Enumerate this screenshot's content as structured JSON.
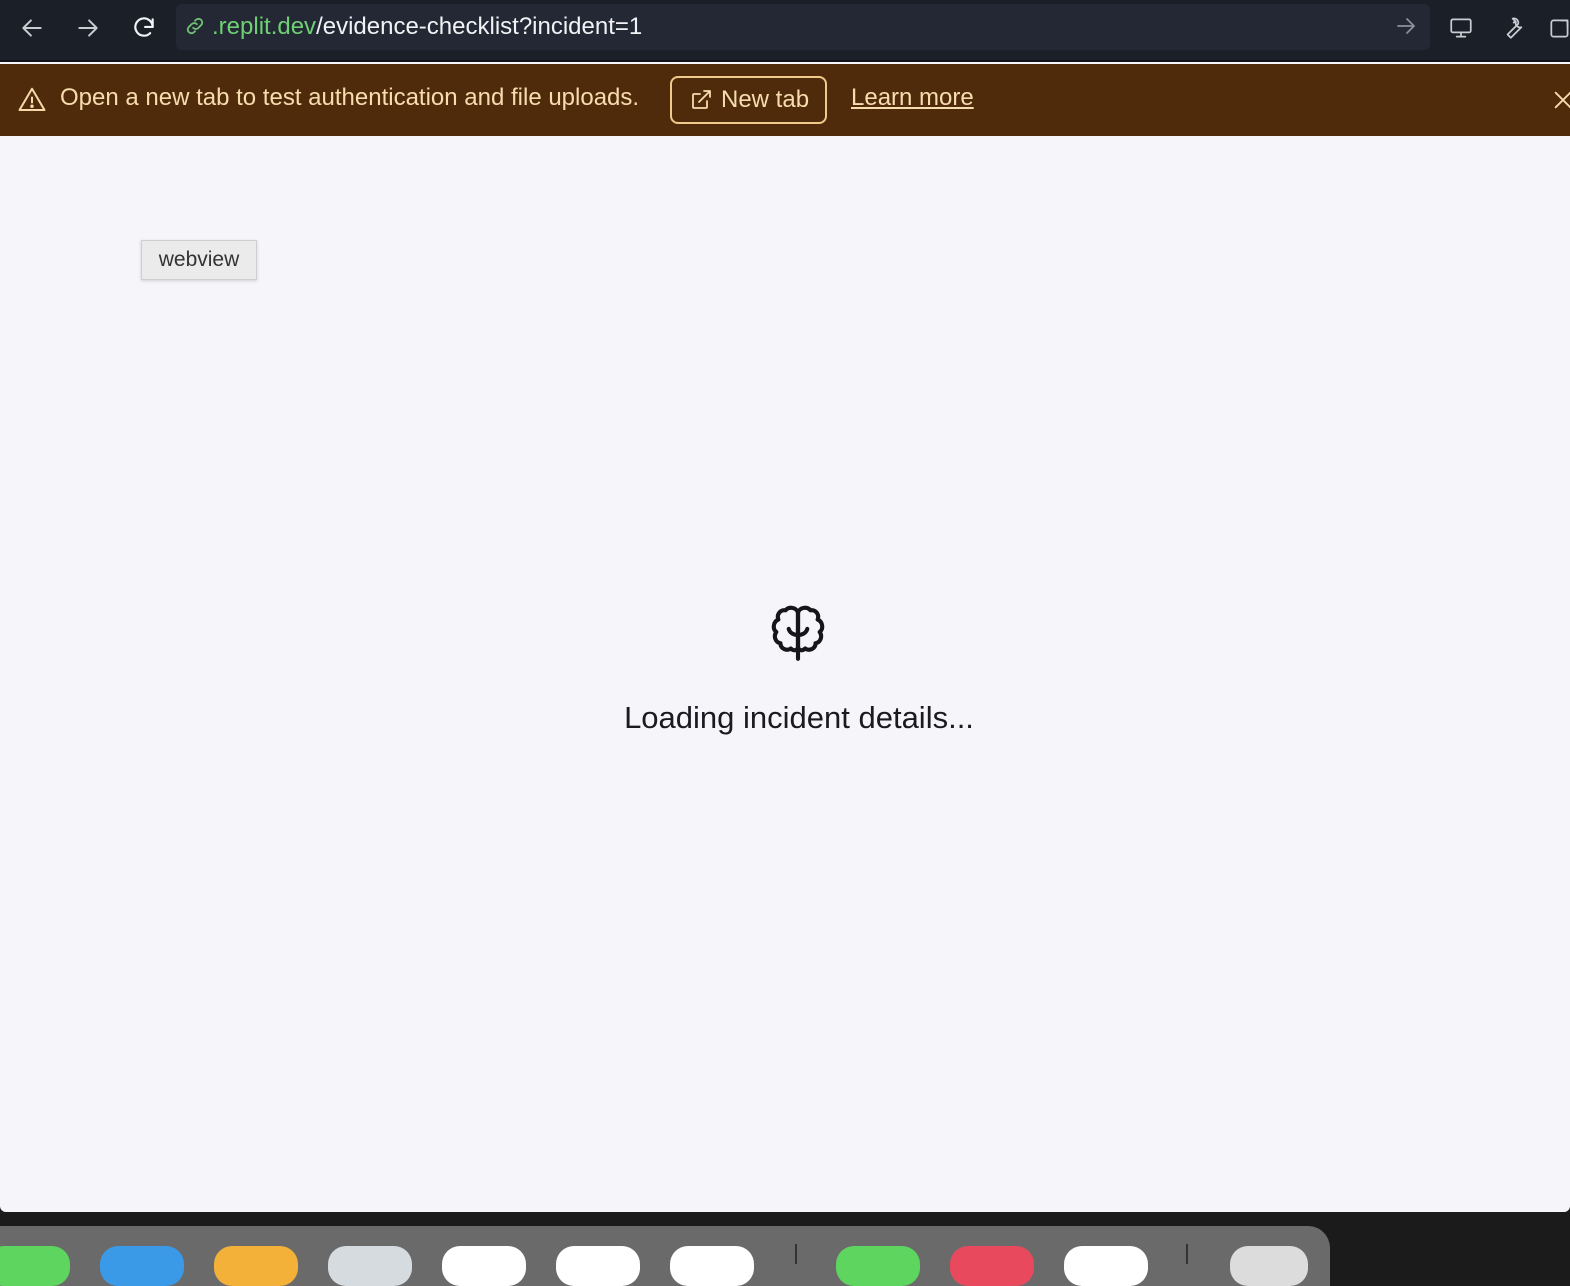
{
  "toolbar": {
    "url_host": ".replit.dev",
    "url_path": "/evidence-checklist?incident=1"
  },
  "banner": {
    "message": "Open a new tab to test authentication and file uploads.",
    "new_tab_label": "New tab",
    "learn_more_label": "Learn more"
  },
  "webview_label": "webview",
  "loading": {
    "message": "Loading incident details..."
  },
  "colors": {
    "toolbar_bg": "#1b1f28",
    "banner_bg": "#4f2b0c",
    "banner_text": "#f7dcae",
    "url_host": "#6fcf74",
    "page_bg": "#f6f5fa"
  },
  "dock": {
    "items": [
      "messages",
      "finder",
      "notes",
      "chrome",
      "calendar",
      "app",
      "safari",
      "facetime",
      "music",
      "app2",
      "trash"
    ]
  }
}
